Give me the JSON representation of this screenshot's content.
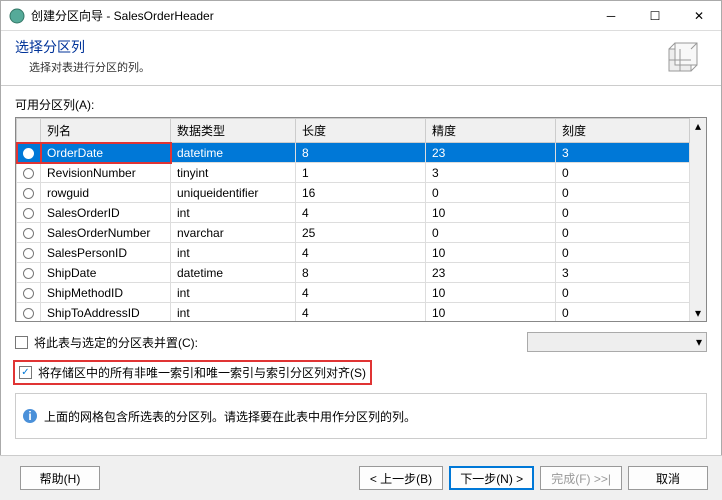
{
  "window": {
    "title": "创建分区向导 - SalesOrderHeader",
    "heading": "选择分区列",
    "subheading": "选择对表进行分区的列。"
  },
  "section_label": "可用分区列(A):",
  "columns": {
    "name": "列名",
    "type": "数据类型",
    "len": "长度",
    "prec": "精度",
    "scale": "刻度"
  },
  "rows": [
    {
      "name": "OrderDate",
      "type": "datetime",
      "len": "8",
      "prec": "23",
      "scale": "3",
      "selected": true
    },
    {
      "name": "RevisionNumber",
      "type": "tinyint",
      "len": "1",
      "prec": "3",
      "scale": "0"
    },
    {
      "name": "rowguid",
      "type": "uniqueidentifier",
      "len": "16",
      "prec": "0",
      "scale": "0"
    },
    {
      "name": "SalesOrderID",
      "type": "int",
      "len": "4",
      "prec": "10",
      "scale": "0"
    },
    {
      "name": "SalesOrderNumber",
      "type": "nvarchar",
      "len": "25",
      "prec": "0",
      "scale": "0"
    },
    {
      "name": "SalesPersonID",
      "type": "int",
      "len": "4",
      "prec": "10",
      "scale": "0"
    },
    {
      "name": "ShipDate",
      "type": "datetime",
      "len": "8",
      "prec": "23",
      "scale": "3"
    },
    {
      "name": "ShipMethodID",
      "type": "int",
      "len": "4",
      "prec": "10",
      "scale": "0"
    },
    {
      "name": "ShipToAddressID",
      "type": "int",
      "len": "4",
      "prec": "10",
      "scale": "0"
    }
  ],
  "chk1": {
    "label": "将此表与选定的分区表并置(C):",
    "checked": false
  },
  "chk2": {
    "label": "将存储区中的所有非唯一索引和唯一索引与索引分区列对齐(S)",
    "checked": true
  },
  "info": "上面的网格包含所选表的分区列。请选择要在此表中用作分区列的列。",
  "buttons": {
    "help": "帮助(H)",
    "back": "< 上一步(B)",
    "next": "下一步(N) >",
    "finish": "完成(F) >>|",
    "cancel": "取消"
  }
}
